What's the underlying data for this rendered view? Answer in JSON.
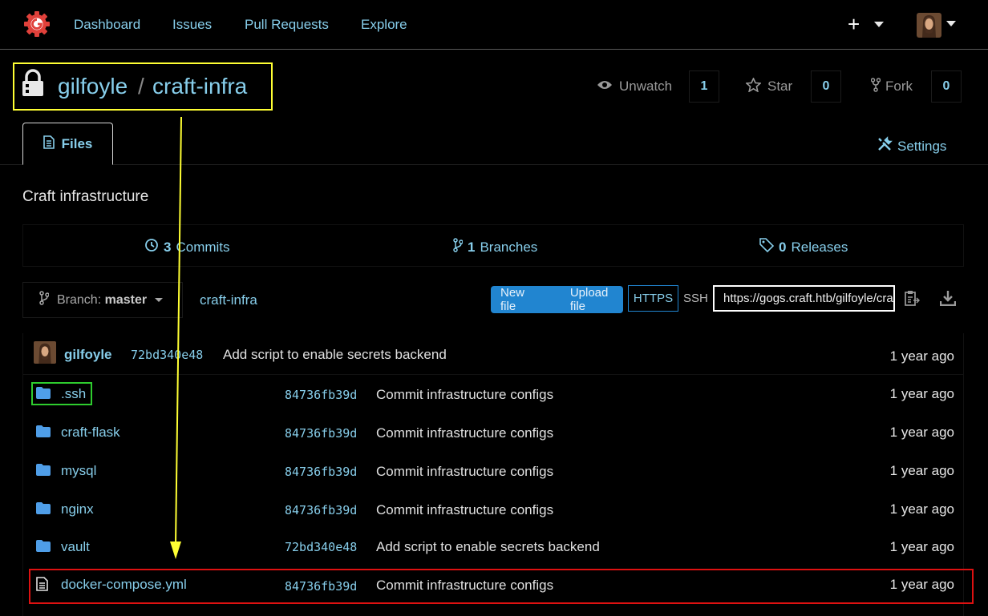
{
  "nav": {
    "items": [
      "Dashboard",
      "Issues",
      "Pull Requests",
      "Explore"
    ],
    "plus": "+"
  },
  "repo": {
    "owner": "gilfoyle",
    "separator": "/",
    "name": "craft-infra",
    "watch_label": "Unwatch",
    "watch_count": "1",
    "star_label": "Star",
    "star_count": "0",
    "fork_label": "Fork",
    "fork_count": "0"
  },
  "tabs": {
    "files": "Files",
    "settings": "Settings"
  },
  "description": "Craft infrastructure",
  "stats": {
    "commits_count": "3",
    "commits_label": "Commits",
    "branches_count": "1",
    "branches_label": "Branches",
    "releases_count": "0",
    "releases_label": "Releases"
  },
  "toolbar": {
    "branch_prefix": "Branch:",
    "branch_name": "master",
    "breadcrumb": "craft-infra",
    "new_file": "New file",
    "upload_file": "Upload file",
    "https": "HTTPS",
    "ssh": "SSH",
    "clone_url": "https://gogs.craft.htb/gilfoyle/craft-infra.git"
  },
  "latest_commit": {
    "author": "gilfoyle",
    "sha": "72bd340e48",
    "message": "Add script to enable secrets backend",
    "age": "1 year ago"
  },
  "files": [
    {
      "name": ".ssh",
      "type": "folder",
      "sha": "84736fb39d",
      "message": "Commit infrastructure configs",
      "age": "1 year ago"
    },
    {
      "name": "craft-flask",
      "type": "folder",
      "sha": "84736fb39d",
      "message": "Commit infrastructure configs",
      "age": "1 year ago"
    },
    {
      "name": "mysql",
      "type": "folder",
      "sha": "84736fb39d",
      "message": "Commit infrastructure configs",
      "age": "1 year ago"
    },
    {
      "name": "nginx",
      "type": "folder",
      "sha": "84736fb39d",
      "message": "Commit infrastructure configs",
      "age": "1 year ago"
    },
    {
      "name": "vault",
      "type": "folder",
      "sha": "72bd340e48",
      "message": "Add script to enable secrets backend",
      "age": "1 year ago"
    },
    {
      "name": "docker-compose.yml",
      "type": "file",
      "sha": "84736fb39d",
      "message": "Commit infrastructure configs",
      "age": "1 year ago"
    }
  ],
  "colors": {
    "link": "#87ceeb",
    "primary": "#2185d0",
    "highlight_title": "#ffff33",
    "highlight_ssh": "#2ecc2e",
    "highlight_compose": "#dd1111"
  }
}
